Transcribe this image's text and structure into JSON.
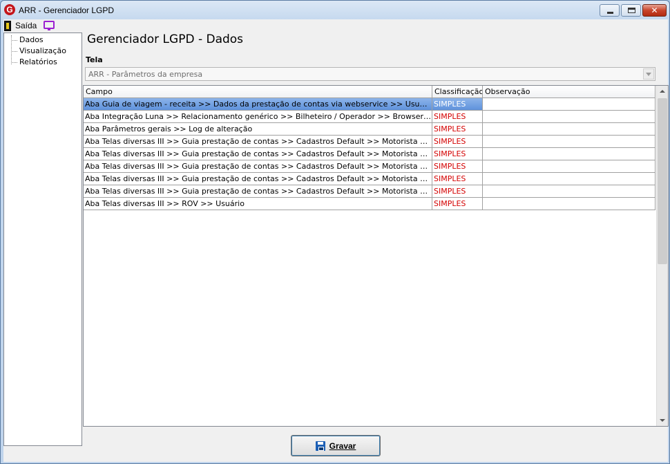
{
  "window": {
    "logo_letter": "G",
    "title": "ARR - Gerenciador LGPD",
    "minimize_glyph": "",
    "close_glyph": "✕"
  },
  "menu": {
    "exit_label": "Saída",
    "icons": [
      "exit-door-icon",
      "monitor-icon"
    ]
  },
  "tree": {
    "items": [
      {
        "label": "Dados"
      },
      {
        "label": "Visualização"
      },
      {
        "label": "Relatórios"
      }
    ]
  },
  "main": {
    "page_title": "Gerenciador LGPD - Dados",
    "tela_label": "Tela",
    "tela_value": "ARR - Parâmetros da empresa"
  },
  "grid": {
    "headers": [
      "Campo",
      "Classificação",
      "Observação"
    ],
    "selected_row": 0,
    "rows": [
      {
        "campo": "Aba Guia de viagem - receita >> Dados da prestação de contas via webservice >> Usuário",
        "classificacao": "SIMPLES",
        "observacao": ""
      },
      {
        "campo": "Aba Integração Luna >> Relacionamento genérico >> Bilheteiro / Operador >> Browser de pesquisa >> ...",
        "classificacao": "SIMPLES",
        "observacao": ""
      },
      {
        "campo": "Aba Parâmetros gerais >> Log de alteração",
        "classificacao": "SIMPLES",
        "observacao": ""
      },
      {
        "campo": "Aba Telas diversas III >> Guia prestação de contas >> Cadastros Default >> Motorista >> Browser de pe...",
        "classificacao": "SIMPLES",
        "observacao": ""
      },
      {
        "campo": "Aba Telas diversas III >> Guia prestação de contas >> Cadastros Default >> Motorista >> Browser de pe...",
        "classificacao": "SIMPLES",
        "observacao": ""
      },
      {
        "campo": "Aba Telas diversas III >> Guia prestação de contas >> Cadastros Default >> Motorista >> Browser de pe...",
        "classificacao": "SIMPLES",
        "observacao": ""
      },
      {
        "campo": "Aba Telas diversas III >> Guia prestação de contas >> Cadastros Default >> Motorista >> Browser de pe...",
        "classificacao": "SIMPLES",
        "observacao": ""
      },
      {
        "campo": "Aba Telas diversas III >> Guia prestação de contas >> Cadastros Default >> Motorista >> Browser de pe...",
        "classificacao": "SIMPLES",
        "observacao": ""
      },
      {
        "campo": "Aba Telas diversas III >> ROV >> Usuário",
        "classificacao": "SIMPLES",
        "observacao": ""
      }
    ]
  },
  "footer": {
    "save_label": "Gravar"
  },
  "colors": {
    "classification_text": "#d40000",
    "selection": "#5f92dc"
  }
}
